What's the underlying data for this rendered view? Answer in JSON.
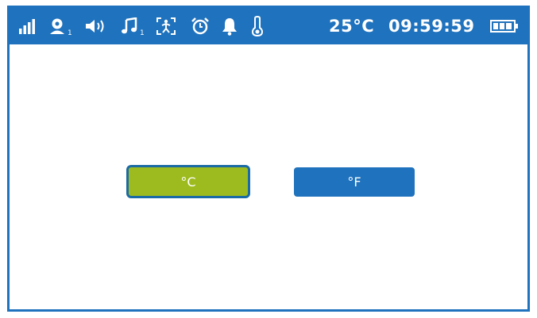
{
  "status_bar": {
    "background_color": "#1f72bd",
    "icons": {
      "signal": "signal-strength-icon",
      "camera": "camera-user-icon",
      "camera_sub": "1",
      "volume": "speaker-volume-icon",
      "music": "music-note-icon",
      "music_sub": "1",
      "motion": "motion-tracking-icon",
      "alarm": "alarm-clock-icon",
      "bell": "bell-icon",
      "thermometer": "thermometer-icon",
      "battery": "battery-icon"
    },
    "temperature": "25°C",
    "time": "09:59:59"
  },
  "unit_selection": {
    "celsius_label": "°C",
    "fahrenheit_label": "°F",
    "selected": "°C",
    "selected_color": "#9dbb1e",
    "unselected_color": "#1f72bd"
  }
}
